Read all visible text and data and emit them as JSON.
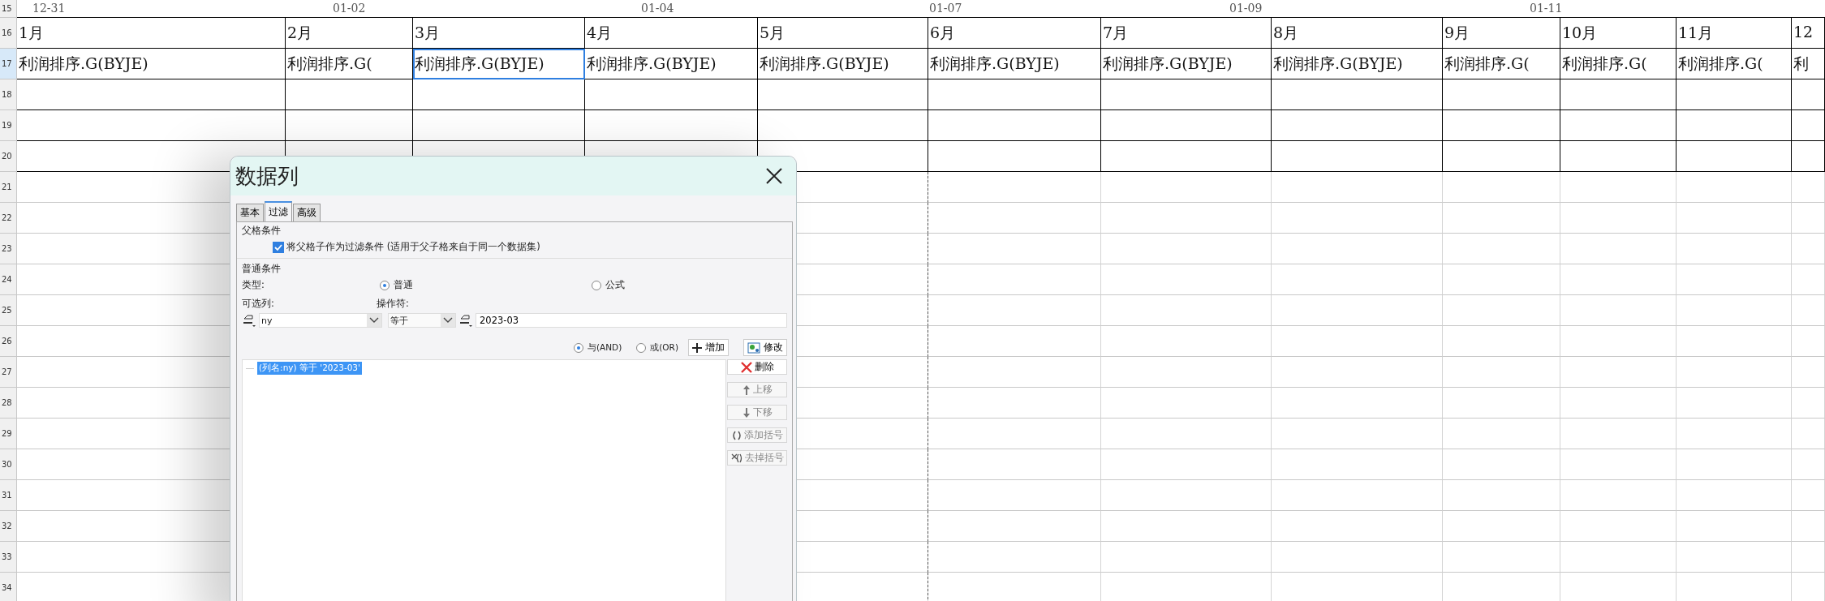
{
  "column_ticks": [
    "12-31",
    "01-02",
    "01-04",
    "01-07",
    "01-09",
    "01-11"
  ],
  "row_numbers": [
    "15",
    "16",
    "17",
    "18",
    "19",
    "20",
    "21",
    "22",
    "23",
    "24",
    "25",
    "26",
    "27",
    "28",
    "29",
    "30",
    "31",
    "32",
    "33",
    "34"
  ],
  "months": [
    "1月",
    "2月",
    "3月",
    "4月",
    "5月",
    "6月",
    "7月",
    "8月",
    "9月",
    "10月",
    "11月",
    "12"
  ],
  "formulas": [
    {
      "text": "利润排序.G(BYJE)",
      "selected": false
    },
    {
      "text": "利润排序.G(",
      "selected": false
    },
    {
      "text": "利润排序.G(BYJE)",
      "selected": true
    },
    {
      "text": "利润排序.G(BYJE)",
      "selected": false
    },
    {
      "text": "利润排序.G(BYJE)",
      "selected": false
    },
    {
      "text": "利润排序.G(BYJE)",
      "selected": false
    },
    {
      "text": "利润排序.G(BYJE)",
      "selected": false
    },
    {
      "text": "利润排序.G(BYJE)",
      "selected": false
    },
    {
      "text": "利润排序.G(",
      "selected": false
    },
    {
      "text": "利润排序.G(",
      "selected": false
    },
    {
      "text": "利润排序.G(",
      "selected": false
    },
    {
      "text": "利",
      "selected": false
    }
  ],
  "dialog": {
    "title": "数据列",
    "tabs": [
      {
        "label": "基本",
        "selected": false
      },
      {
        "label": "过滤",
        "selected": true
      },
      {
        "label": "高级",
        "selected": false
      }
    ],
    "parent_condition": {
      "title": "父格条件",
      "checkbox": {
        "label": "将父格子作为过滤条件 (适用于父子格来自于同一个数据集)",
        "checked": true
      }
    },
    "normal_condition": {
      "title": "普通条件",
      "type_label": "类型:",
      "types": [
        {
          "label": "普通",
          "selected": true
        },
        {
          "label": "公式",
          "selected": false
        }
      ],
      "column_label": "可选列:",
      "operator_label": "操作符:",
      "column_value": "ny",
      "operator_value": "等于",
      "value": "2023-03",
      "joins": [
        {
          "label": "与(AND)",
          "selected": true
        },
        {
          "label": "或(OR)",
          "selected": false
        }
      ],
      "add_button": "增加",
      "modify_button": "修改",
      "conditions": [
        {
          "text": "(列名:ny) 等于 '2023-03'",
          "selected": true
        }
      ],
      "side_buttons": [
        {
          "label": "删除",
          "kind": "delete",
          "disabled": false
        },
        {
          "label": "上移",
          "kind": "up",
          "disabled": true
        },
        {
          "label": "下移",
          "kind": "down",
          "disabled": true
        },
        {
          "label": "添加括号",
          "kind": "add-brackets",
          "disabled": true
        },
        {
          "label": "去掉括号",
          "kind": "remove-brackets",
          "disabled": true
        }
      ]
    }
  }
}
